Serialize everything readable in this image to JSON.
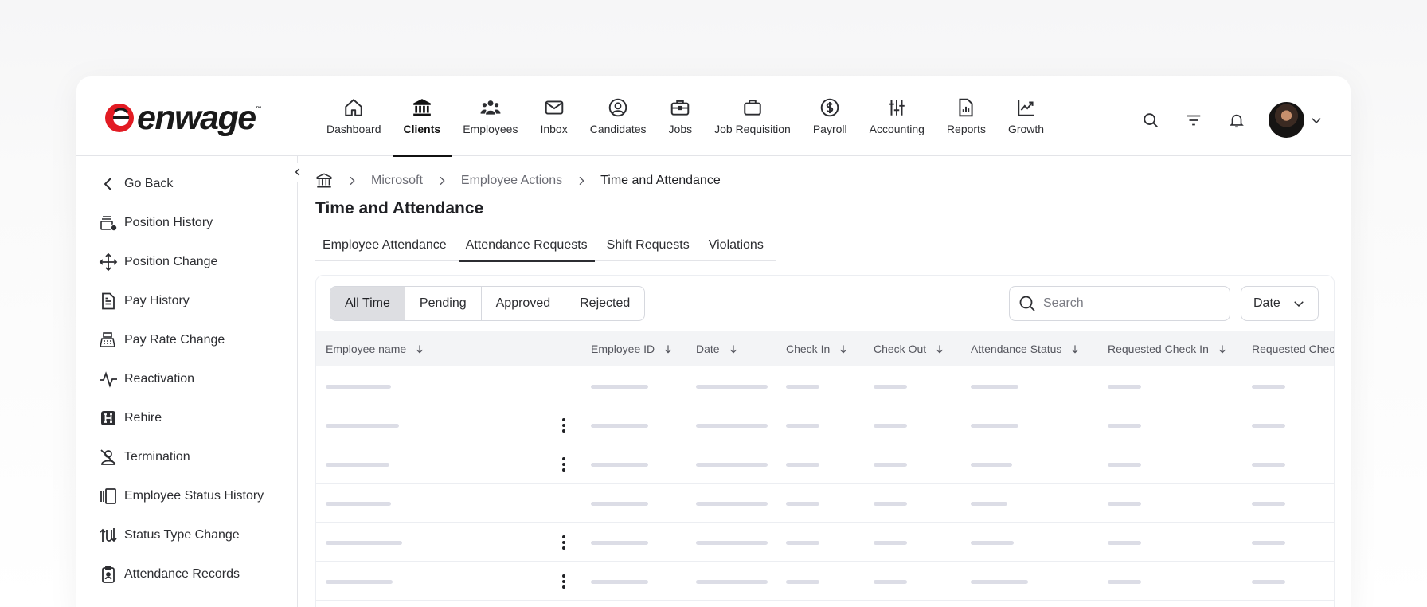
{
  "brand": {
    "name": "enwage",
    "trademark": "™",
    "accent_color": "#e21b23"
  },
  "nav": [
    {
      "label": "Dashboard",
      "icon": "home-icon",
      "active": false
    },
    {
      "label": "Clients",
      "icon": "bank-icon",
      "active": true
    },
    {
      "label": "Employees",
      "icon": "users-icon",
      "active": false
    },
    {
      "label": "Inbox",
      "icon": "mail-icon",
      "active": false
    },
    {
      "label": "Candidates",
      "icon": "user-circle-icon",
      "active": false
    },
    {
      "label": "Jobs",
      "icon": "briefcase-icon",
      "active": false
    },
    {
      "label": "Job Requisition",
      "icon": "bag-icon",
      "active": false
    },
    {
      "label": "Payroll",
      "icon": "dollar-icon",
      "active": false
    },
    {
      "label": "Accounting",
      "icon": "sliders-icon",
      "active": false
    },
    {
      "label": "Reports",
      "icon": "report-icon",
      "active": false
    },
    {
      "label": "Growth",
      "icon": "trend-icon",
      "active": false
    }
  ],
  "sidebar": {
    "items": [
      {
        "label": "Go Back",
        "icon": "chevron-left-icon"
      },
      {
        "label": "Position History",
        "icon": "position-history-icon"
      },
      {
        "label": "Position Change",
        "icon": "move-icon"
      },
      {
        "label": "Pay History",
        "icon": "document-icon"
      },
      {
        "label": "Pay Rate Change",
        "icon": "register-icon"
      },
      {
        "label": "Reactivation",
        "icon": "pulse-icon"
      },
      {
        "label": "Rehire",
        "icon": "h-badge-icon"
      },
      {
        "label": "Termination",
        "icon": "user-off-icon"
      },
      {
        "label": "Employee Status History",
        "icon": "status-history-icon"
      },
      {
        "label": "Status Type Change",
        "icon": "status-change-icon"
      },
      {
        "label": "Attendance Records",
        "icon": "clipboard-icon"
      }
    ]
  },
  "breadcrumb": {
    "root_icon": "bank-icon",
    "items": [
      "Microsoft",
      "Employee Actions",
      "Time and Attendance"
    ]
  },
  "page": {
    "title": "Time and Attendance"
  },
  "tabs": [
    {
      "label": "Employee Attendance",
      "active": false
    },
    {
      "label": "Attendance Requests",
      "active": true
    },
    {
      "label": "Shift Requests",
      "active": false
    },
    {
      "label": "Violations",
      "active": false
    }
  ],
  "filters": [
    {
      "label": "All Time",
      "active": true
    },
    {
      "label": "Pending",
      "active": false
    },
    {
      "label": "Approved",
      "active": false
    },
    {
      "label": "Rejected",
      "active": false
    }
  ],
  "search": {
    "placeholder": "Search"
  },
  "date_select": {
    "label": "Date"
  },
  "table": {
    "columns": [
      "Employee name",
      "Employee ID",
      "Date",
      "Check In",
      "Check Out",
      "Attendance Status",
      "Requested Check In",
      "Requested Chec"
    ],
    "rows": [
      {
        "kebab": false
      },
      {
        "kebab": true
      },
      {
        "kebab": true
      },
      {
        "kebab": false
      },
      {
        "kebab": true
      },
      {
        "kebab": true
      }
    ]
  }
}
